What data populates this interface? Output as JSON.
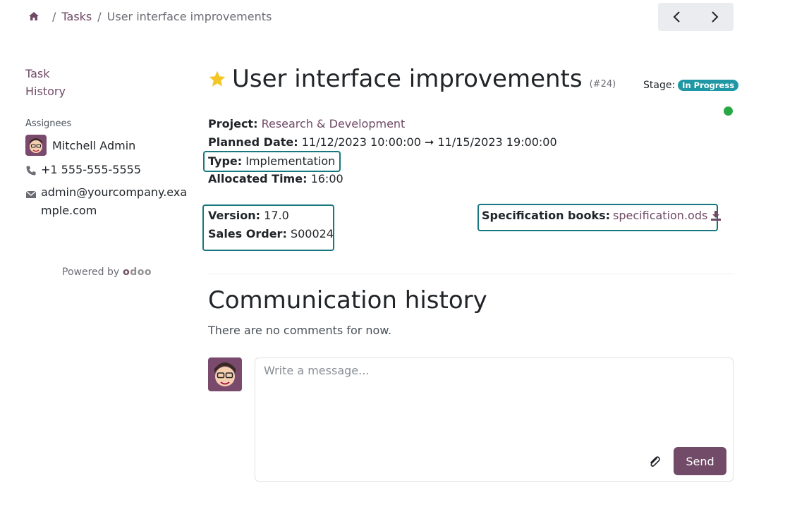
{
  "breadcrumb": {
    "home_icon": "home-icon",
    "items": [
      "Tasks",
      "User interface improvements"
    ]
  },
  "pager": {
    "prev_icon": "chevron-left-icon",
    "next_icon": "chevron-right-icon"
  },
  "sidebar": {
    "links": [
      "Task",
      "History"
    ],
    "assignees_label": "Assignees",
    "assignee_name": "Mitchell Admin",
    "phone": "+1 555-555-5555",
    "email": "admin@yourcompany.example.com",
    "powered_by": "Powered by",
    "powered_logo": "odoo"
  },
  "task": {
    "title": "User interface improvements",
    "id": "(#24)",
    "stage_label": "Stage:",
    "stage_value": "In Progress",
    "fields": {
      "project": {
        "label": "Project:",
        "value": "Research & Development"
      },
      "planned": {
        "label": "Planned Date:",
        "value": "11/12/2023 10:00:00 ➞ 11/15/2023 19:00:00"
      },
      "type": {
        "label": "Type:",
        "value": "Implementation"
      },
      "allocated": {
        "label": "Allocated Time:",
        "value": "16:00"
      },
      "version": {
        "label": "Version:",
        "value": "17.0"
      },
      "sales_order": {
        "label": "Sales Order:",
        "value": "S00024"
      },
      "spec": {
        "label": "Specification books:",
        "value": "specification.ods"
      }
    }
  },
  "communication": {
    "title": "Communication history",
    "empty": "There are no comments for now.",
    "placeholder": "Write a message...",
    "send_label": "Send"
  },
  "colors": {
    "accent": "#714b67",
    "link": "#6f4a66",
    "badge": "#1f97a4",
    "highlight": "#167780",
    "status": "#28a745"
  }
}
